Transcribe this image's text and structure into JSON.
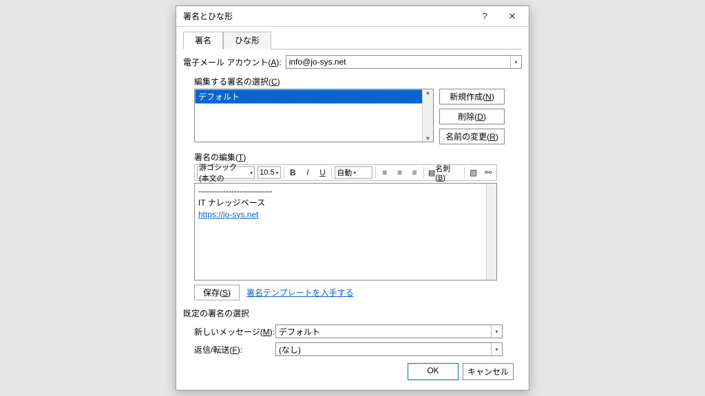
{
  "titlebar": {
    "title": "署名とひな形"
  },
  "tabs": {
    "signature": "署名",
    "stationery": "ひな形"
  },
  "account": {
    "label": "電子メール アカウント(A):",
    "value": "info@jo-sys.net"
  },
  "siglist": {
    "label": "編集する署名の選択(C)",
    "items": [
      "デフォルト"
    ],
    "new_btn": "新規作成(N)",
    "delete_btn": "削除(D)",
    "rename_btn": "名前の変更(R)"
  },
  "editsig": {
    "label": "署名の編集(T)",
    "font": "游ゴシック (本文の",
    "size": "10.5",
    "auto": "自動",
    "bcard": "名刺(B)",
    "content_line1": "---------------------------",
    "content_line2": "IT ナレッジベース",
    "content_link": "https://jo-sys.net",
    "save_btn": "保存(S)",
    "template_link": "署名テンプレートを入手する"
  },
  "defaults": {
    "label": "既定の署名の選択",
    "newmsg_label": "新しいメッセージ(M):",
    "newmsg_value": "デフォルト",
    "reply_label": "返信/転送(F):",
    "reply_value": "(なし)"
  },
  "footer": {
    "ok": "OK",
    "cancel": "キャンセル"
  }
}
